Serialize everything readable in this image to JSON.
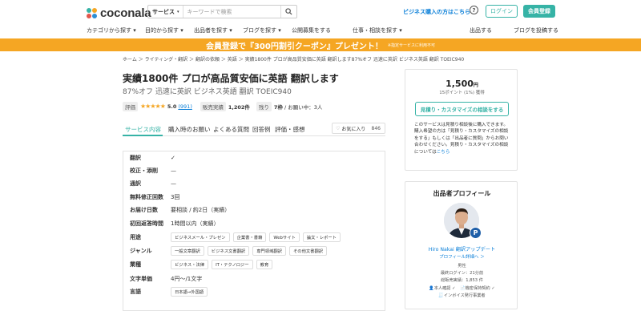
{
  "header": {
    "logo_text": "coconala",
    "search": {
      "category": "サービス",
      "placeholder": "キーワードで検索"
    },
    "business_link": "ビジネス購入の方はこちら",
    "login": "ログイン",
    "register": "会員登録",
    "brand_color": "#36b3a6",
    "link_color": "#0a7fd8"
  },
  "nav": {
    "items": [
      "カテゴリから探す",
      "目的から探す",
      "出品者を探す",
      "ブログを探す",
      "公開募集をする",
      "仕事・相談を探す",
      "出品する",
      "ブログを投稿する"
    ]
  },
  "banner": {
    "text": "会員登録で『300円割引クーポン』プレゼント！",
    "note": "※指定サービスに利用不可",
    "color": "#f5a623"
  },
  "breadcrumb": "ホーム ＞ ライティング・翻訳 ＞ 翻訳の依頼 ＞ 英語 ＞ 実績1800件 プロが高品質安価に英語 翻訳します87%オフ 迅速に英訳 ビジネス英語 翻訳 TOEIC940",
  "service": {
    "title": "実績1800件 プロが高品質安価に英語 翻訳します",
    "subtitle": "87%オフ 迅速に英訳 ビジネス英語 翻訳 TOEIC940",
    "rating_label": "評価",
    "rating": "5.0",
    "reviews": "(991)",
    "sales_label": "販売実績",
    "sales": "1,202件",
    "remaining_label": "残り",
    "remaining": "7枠",
    "in_progress": "/ お願い中：3人"
  },
  "tabs": [
    "サービス内容",
    "購入時のお願い",
    "よくある質問",
    "回答例",
    "評価・感想"
  ],
  "favorite": {
    "label": "お気に入り",
    "count": "846"
  },
  "spec": {
    "rows": [
      {
        "label": "翻訳",
        "value": "✓"
      },
      {
        "label": "校正・添削",
        "value": "—"
      },
      {
        "label": "通訳",
        "value": "—"
      },
      {
        "label": "無料修正回数",
        "value": "3回"
      },
      {
        "label": "お届け日数",
        "value": "要相談 / 約2日（実績）"
      },
      {
        "label": "初回返答時間",
        "value": "1時間以内（実績）"
      }
    ],
    "chip_rows": [
      {
        "label": "用途",
        "chips": [
          "ビジネスメール・プレゼン",
          "企業書・書籍",
          "Webサイト",
          "論文・レポート"
        ]
      },
      {
        "label": "ジャンル",
        "chips": [
          "一般文章翻訳",
          "ビジネス文書翻訳",
          "専門領域翻訳",
          "その他文書翻訳"
        ]
      },
      {
        "label": "業種",
        "chips": [
          "ビジネス・法律",
          "IT・テクノロジー",
          "教育"
        ]
      }
    ],
    "unit": {
      "label": "文字単価",
      "value": "4円〜/1文字"
    },
    "language": {
      "label": "言語",
      "chips": [
        "日本語→外国語"
      ]
    }
  },
  "pricing": {
    "price": "1,500",
    "yen": "円",
    "points": "15ポイント (1%) 獲得",
    "consult_button": "見積り・カスタマイズの相談をする",
    "note": "このサービスは見積り相談後に購入できます。購入希望の方は「見積り・カスタマイズの相談をする」もしくは「出品者に質問」からお問い合わせください。見積り・カスタマイズの相談については",
    "note_link": "こちら"
  },
  "profile": {
    "title": "出品者プロフィール",
    "name": "Hiro Nakai 翻訳アップデート",
    "link": "プロフィール詳細へ ＞",
    "gender": "男性",
    "last_login": "最終ログイン：21分前",
    "sales": "総販売実績：1,853 件",
    "verify1": "本人確認 ✓",
    "verify2": "機密保持契約 ✓",
    "invoice": "インボイス発行事業者"
  }
}
